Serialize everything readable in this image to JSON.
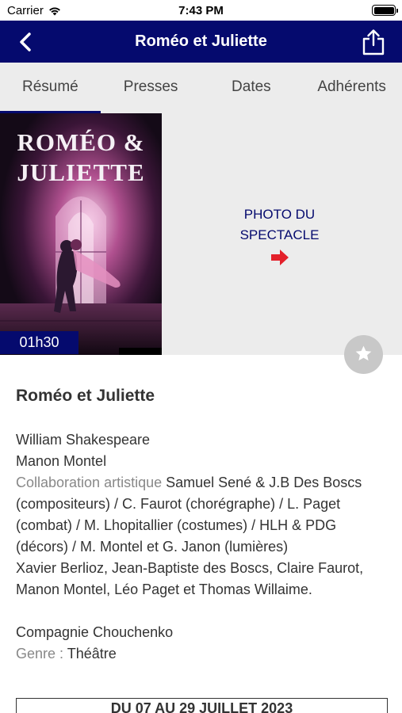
{
  "status_bar": {
    "carrier": "Carrier",
    "time": "7:43 PM"
  },
  "navbar": {
    "title": "Roméo et Juliette"
  },
  "tabs": [
    {
      "label": "Résumé",
      "active": true
    },
    {
      "label": "Presses"
    },
    {
      "label": "Dates"
    },
    {
      "label": "Adhérents"
    }
  ],
  "poster": {
    "title_line1": "ROMÉO &",
    "title_line2": "JULIETTE"
  },
  "duration": "01h30",
  "photo_link": {
    "line1": "PHOTO DU",
    "line2": "SPECTACLE"
  },
  "details": {
    "title": "Roméo et Juliette",
    "author": "William Shakespeare",
    "director": "Manon Montel",
    "collaboration_label": "Collaboration artistique",
    "collaboration_text": "Samuel Sené & J.B Des Boscs (compositeurs) / C. Faurot (chorégraphe) / L. Paget (combat) / M. Lhopitallier (costumes) / HLH & PDG (décors) / M. Montel et G. Janon (lumières)",
    "cast": "Xavier Berlioz, Jean-Baptiste des Boscs, Claire Faurot, Manon Montel, Léo Paget et Thomas Willaime.",
    "company": "Compagnie Chouchenko",
    "genre_label": "Genre :",
    "genre_value": "Théâtre"
  },
  "dates_box": "DU 07 AU 29 JUILLET 2023",
  "colors": {
    "nav": "#050a6e",
    "accent_arrow": "#e3202a",
    "tab_bg": "#ececec"
  }
}
